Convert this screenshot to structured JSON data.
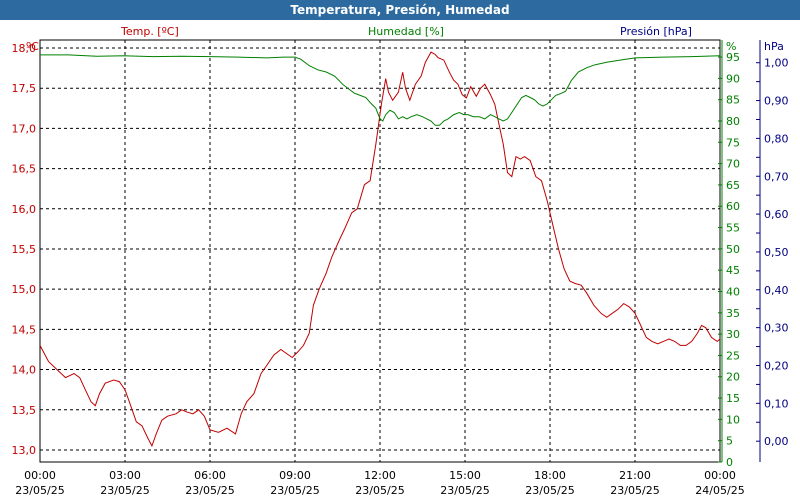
{
  "header": {
    "title": "Temperatura, Presión, Humedad"
  },
  "chart_data": {
    "type": "line",
    "title": "Temperatura, Presión, Humedad",
    "x_ticks": [
      {
        "time": "00:00",
        "date": "23/05/25"
      },
      {
        "time": "03:00",
        "date": "23/05/25"
      },
      {
        "time": "06:00",
        "date": "23/05/25"
      },
      {
        "time": "09:00",
        "date": "23/05/25"
      },
      {
        "time": "12:00",
        "date": "23/05/25"
      },
      {
        "time": "15:00",
        "date": "23/05/25"
      },
      {
        "time": "18:00",
        "date": "23/05/25"
      },
      {
        "time": "21:00",
        "date": "23/05/25"
      },
      {
        "time": "00:00",
        "date": "24/05/25"
      }
    ],
    "axes": {
      "temp": {
        "label": "Temp. [ºC]",
        "unit": "ºC",
        "min": 12.85,
        "max": 18.1,
        "ticks": [
          "13,0",
          "13,5",
          "14,0",
          "14,5",
          "15,0",
          "15,5",
          "16,0",
          "16,5",
          "17,0",
          "17,5",
          "18,0"
        ],
        "color": "#c00000"
      },
      "hum": {
        "label": "Humedad [%]",
        "unit": "%",
        "min": 0,
        "max": 99,
        "ticks": [
          "0",
          "5",
          "10",
          "15",
          "20",
          "25",
          "30",
          "35",
          "40",
          "45",
          "50",
          "55",
          "60",
          "65",
          "70",
          "75",
          "80",
          "85",
          "90",
          "95"
        ],
        "color": "#008000"
      },
      "pres": {
        "label": "Presión [hPa]",
        "unit": "hPa",
        "min": -0.055,
        "max": 1.06,
        "ticks": [
          "0,00",
          "0,10",
          "0,20",
          "0,30",
          "0,40",
          "0,50",
          "0,60",
          "0,70",
          "0,80",
          "0,90",
          "1,00"
        ],
        "color": "#000080"
      }
    },
    "grid": true,
    "series": [
      {
        "name": "Temp. [ºC]",
        "axis": "temp",
        "color": "#c00000",
        "points": [
          [
            0.0,
            14.3
          ],
          [
            0.3,
            14.1
          ],
          [
            0.6,
            14.0
          ],
          [
            0.9,
            13.9
          ],
          [
            1.2,
            13.95
          ],
          [
            1.4,
            13.9
          ],
          [
            1.6,
            13.75
          ],
          [
            1.8,
            13.6
          ],
          [
            1.95,
            13.55
          ],
          [
            2.1,
            13.7
          ],
          [
            2.3,
            13.83
          ],
          [
            2.6,
            13.87
          ],
          [
            2.8,
            13.85
          ],
          [
            3.0,
            13.75
          ],
          [
            3.2,
            13.55
          ],
          [
            3.4,
            13.35
          ],
          [
            3.6,
            13.3
          ],
          [
            3.8,
            13.15
          ],
          [
            3.95,
            13.05
          ],
          [
            4.1,
            13.2
          ],
          [
            4.3,
            13.37
          ],
          [
            4.5,
            13.42
          ],
          [
            4.8,
            13.45
          ],
          [
            5.0,
            13.5
          ],
          [
            5.2,
            13.47
          ],
          [
            5.4,
            13.45
          ],
          [
            5.6,
            13.5
          ],
          [
            5.8,
            13.42
          ],
          [
            6.0,
            13.25
          ],
          [
            6.3,
            13.22
          ],
          [
            6.6,
            13.27
          ],
          [
            6.9,
            13.2
          ],
          [
            7.1,
            13.45
          ],
          [
            7.3,
            13.6
          ],
          [
            7.55,
            13.7
          ],
          [
            7.8,
            13.95
          ],
          [
            8.0,
            14.05
          ],
          [
            8.25,
            14.18
          ],
          [
            8.5,
            14.25
          ],
          [
            8.7,
            14.2
          ],
          [
            8.9,
            14.15
          ],
          [
            9.1,
            14.22
          ],
          [
            9.3,
            14.3
          ],
          [
            9.5,
            14.45
          ],
          [
            9.65,
            14.8
          ],
          [
            9.85,
            15.0
          ],
          [
            10.1,
            15.2
          ],
          [
            10.3,
            15.4
          ],
          [
            10.55,
            15.6
          ],
          [
            10.75,
            15.75
          ],
          [
            11.0,
            15.95
          ],
          [
            11.2,
            16.0
          ],
          [
            11.45,
            16.3
          ],
          [
            11.65,
            16.35
          ],
          [
            11.85,
            16.8
          ],
          [
            12.05,
            17.3
          ],
          [
            12.2,
            17.62
          ],
          [
            12.3,
            17.45
          ],
          [
            12.45,
            17.35
          ],
          [
            12.65,
            17.45
          ],
          [
            12.8,
            17.7
          ],
          [
            12.9,
            17.5
          ],
          [
            13.05,
            17.35
          ],
          [
            13.25,
            17.55
          ],
          [
            13.45,
            17.65
          ],
          [
            13.6,
            17.82
          ],
          [
            13.8,
            17.95
          ],
          [
            13.95,
            17.92
          ],
          [
            14.05,
            17.88
          ],
          [
            14.25,
            17.85
          ],
          [
            14.45,
            17.7
          ],
          [
            14.6,
            17.6
          ],
          [
            14.75,
            17.55
          ],
          [
            14.9,
            17.42
          ],
          [
            15.05,
            17.38
          ],
          [
            15.2,
            17.52
          ],
          [
            15.4,
            17.4
          ],
          [
            15.55,
            17.5
          ],
          [
            15.7,
            17.55
          ],
          [
            15.9,
            17.42
          ],
          [
            16.05,
            17.3
          ],
          [
            16.2,
            17.05
          ],
          [
            16.35,
            16.8
          ],
          [
            16.5,
            16.45
          ],
          [
            16.65,
            16.4
          ],
          [
            16.8,
            16.65
          ],
          [
            16.95,
            16.62
          ],
          [
            17.1,
            16.65
          ],
          [
            17.3,
            16.6
          ],
          [
            17.5,
            16.4
          ],
          [
            17.7,
            16.35
          ],
          [
            17.9,
            16.1
          ],
          [
            18.1,
            15.8
          ],
          [
            18.3,
            15.5
          ],
          [
            18.5,
            15.25
          ],
          [
            18.7,
            15.1
          ],
          [
            18.9,
            15.07
          ],
          [
            19.1,
            15.05
          ],
          [
            19.3,
            14.95
          ],
          [
            19.55,
            14.8
          ],
          [
            19.8,
            14.7
          ],
          [
            20.0,
            14.65
          ],
          [
            20.2,
            14.7
          ],
          [
            20.4,
            14.75
          ],
          [
            20.6,
            14.82
          ],
          [
            20.8,
            14.78
          ],
          [
            21.0,
            14.7
          ],
          [
            21.2,
            14.55
          ],
          [
            21.4,
            14.4
          ],
          [
            21.6,
            14.35
          ],
          [
            21.8,
            14.32
          ],
          [
            22.0,
            14.35
          ],
          [
            22.2,
            14.38
          ],
          [
            22.4,
            14.35
          ],
          [
            22.6,
            14.3
          ],
          [
            22.8,
            14.3
          ],
          [
            23.0,
            14.35
          ],
          [
            23.2,
            14.45
          ],
          [
            23.35,
            14.55
          ],
          [
            23.5,
            14.52
          ],
          [
            23.7,
            14.4
          ],
          [
            23.9,
            14.35
          ],
          [
            24.0,
            14.38
          ],
          [
            24.2,
            14.32
          ],
          [
            24.4,
            14.25
          ]
        ]
      },
      {
        "name": "Humedad [%]",
        "axis": "hum",
        "color": "#008000",
        "points": [
          [
            0.0,
            95.5
          ],
          [
            1.0,
            95.5
          ],
          [
            2.0,
            95.2
          ],
          [
            3.0,
            95.3
          ],
          [
            4.0,
            95.1
          ],
          [
            5.0,
            95.2
          ],
          [
            6.0,
            95.1
          ],
          [
            7.0,
            95.0
          ],
          [
            8.0,
            94.8
          ],
          [
            8.6,
            95.0
          ],
          [
            9.0,
            95.0
          ],
          [
            9.2,
            94.5
          ],
          [
            9.5,
            93.0
          ],
          [
            9.8,
            92.0
          ],
          [
            10.1,
            91.5
          ],
          [
            10.4,
            90.5
          ],
          [
            10.7,
            88.5
          ],
          [
            10.9,
            87.5
          ],
          [
            11.1,
            86.5
          ],
          [
            11.3,
            86.0
          ],
          [
            11.5,
            85.5
          ],
          [
            11.7,
            84.0
          ],
          [
            11.85,
            83.0
          ],
          [
            12.0,
            80.5
          ],
          [
            12.1,
            80.0
          ],
          [
            12.2,
            81.5
          ],
          [
            12.35,
            82.5
          ],
          [
            12.5,
            82.0
          ],
          [
            12.65,
            80.5
          ],
          [
            12.8,
            81.0
          ],
          [
            12.95,
            80.5
          ],
          [
            13.1,
            81.0
          ],
          [
            13.3,
            81.5
          ],
          [
            13.5,
            81.0
          ],
          [
            13.65,
            80.5
          ],
          [
            13.8,
            80.0
          ],
          [
            13.95,
            79.0
          ],
          [
            14.1,
            79.0
          ],
          [
            14.25,
            80.0
          ],
          [
            14.4,
            80.5
          ],
          [
            14.6,
            81.5
          ],
          [
            14.8,
            82.0
          ],
          [
            14.95,
            81.5
          ],
          [
            15.1,
            81.5
          ],
          [
            15.3,
            81.0
          ],
          [
            15.5,
            81.0
          ],
          [
            15.7,
            80.5
          ],
          [
            15.9,
            81.5
          ],
          [
            16.05,
            81.0
          ],
          [
            16.2,
            80.5
          ],
          [
            16.35,
            80.0
          ],
          [
            16.5,
            80.5
          ],
          [
            16.65,
            82.0
          ],
          [
            16.8,
            83.5
          ],
          [
            17.0,
            85.5
          ],
          [
            17.15,
            86.0
          ],
          [
            17.3,
            85.5
          ],
          [
            17.45,
            85.0
          ],
          [
            17.6,
            84.0
          ],
          [
            17.75,
            83.5
          ],
          [
            17.9,
            84.0
          ],
          [
            18.05,
            85.0
          ],
          [
            18.2,
            86.0
          ],
          [
            18.4,
            86.5
          ],
          [
            18.55,
            87.0
          ],
          [
            18.75,
            89.5
          ],
          [
            19.0,
            91.5
          ],
          [
            19.3,
            92.5
          ],
          [
            19.6,
            93.2
          ],
          [
            20.0,
            93.8
          ],
          [
            20.5,
            94.3
          ],
          [
            21.0,
            94.8
          ],
          [
            22.0,
            95.0
          ],
          [
            23.0,
            95.1
          ],
          [
            24.0,
            95.3
          ],
          [
            24.4,
            95.3
          ]
        ]
      }
    ]
  }
}
